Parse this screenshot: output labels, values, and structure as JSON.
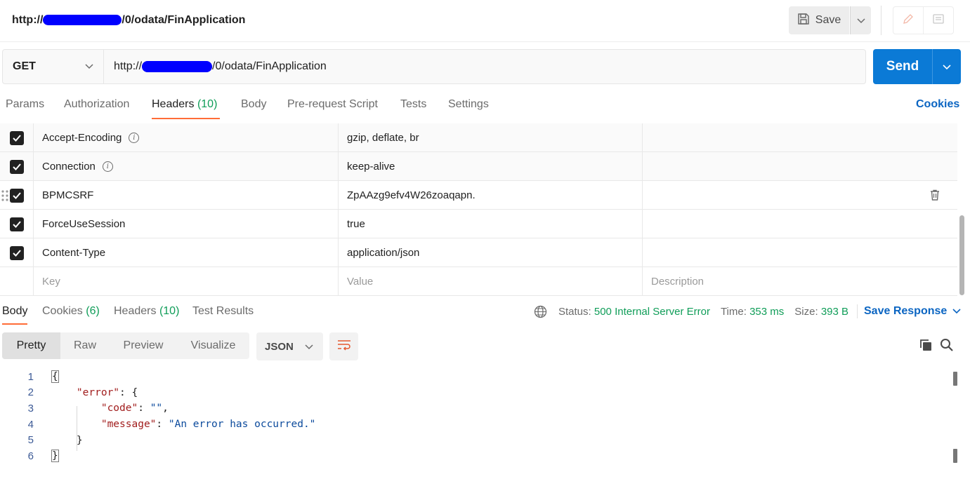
{
  "request": {
    "title_prefix": "http://",
    "title_suffix": "/0/odata/FinApplication",
    "save_label": "Save",
    "method": "GET",
    "url_prefix": "http://",
    "url_suffix": "/0/odata/FinApplication",
    "send_label": "Send"
  },
  "request_tabs": {
    "params": "Params",
    "authorization": "Authorization",
    "headers": "Headers",
    "headers_count": "(10)",
    "body": "Body",
    "prerequest": "Pre-request Script",
    "tests": "Tests",
    "settings": "Settings",
    "cookies": "Cookies"
  },
  "headers": [
    {
      "key": "Accept-Encoding",
      "value": "gzip, deflate, br",
      "checked": true,
      "info": true
    },
    {
      "key": "Connection",
      "value": "keep-alive",
      "checked": true,
      "info": true
    },
    {
      "key": "BPMCSRF",
      "value": "ZpAAzg9efv4W26zoaqapn.",
      "checked": true,
      "info": false
    },
    {
      "key": "ForceUseSession",
      "value": "true",
      "checked": true,
      "info": false
    },
    {
      "key": "Content-Type",
      "value": "application/json",
      "checked": true,
      "info": false
    }
  ],
  "new_header": {
    "key_placeholder": "Key",
    "value_placeholder": "Value",
    "description_placeholder": "Description"
  },
  "response_tabs": {
    "body": "Body",
    "cookies": "Cookies",
    "cookies_count": "(6)",
    "headers": "Headers",
    "headers_count": "(10)",
    "test_results": "Test Results"
  },
  "response_meta": {
    "status_label": "Status:",
    "status_value": "500 Internal Server Error",
    "time_label": "Time:",
    "time_value": "353 ms",
    "size_label": "Size:",
    "size_value": "393 B",
    "save_response": "Save Response"
  },
  "response_view": {
    "modes": [
      "Pretty",
      "Raw",
      "Preview",
      "Visualize"
    ],
    "active_mode": "Pretty",
    "format": "JSON"
  },
  "response_body": {
    "line_numbers": [
      "1",
      "2",
      "3",
      "4",
      "5",
      "6"
    ],
    "open_brace": "{",
    "error_key": "\"error\"",
    "code_key": "\"code\"",
    "code_value": "\"\"",
    "message_key": "\"message\"",
    "message_value": "\"An error has occurred.\"",
    "close_inner": "}",
    "close_brace": "}"
  },
  "colors": {
    "accent_orange": "#ff6c37",
    "send_blue": "#0b7ad6",
    "status_green": "#0f9d58",
    "link_blue": "#0b65c2",
    "redaction_blue": "#0000ff"
  }
}
